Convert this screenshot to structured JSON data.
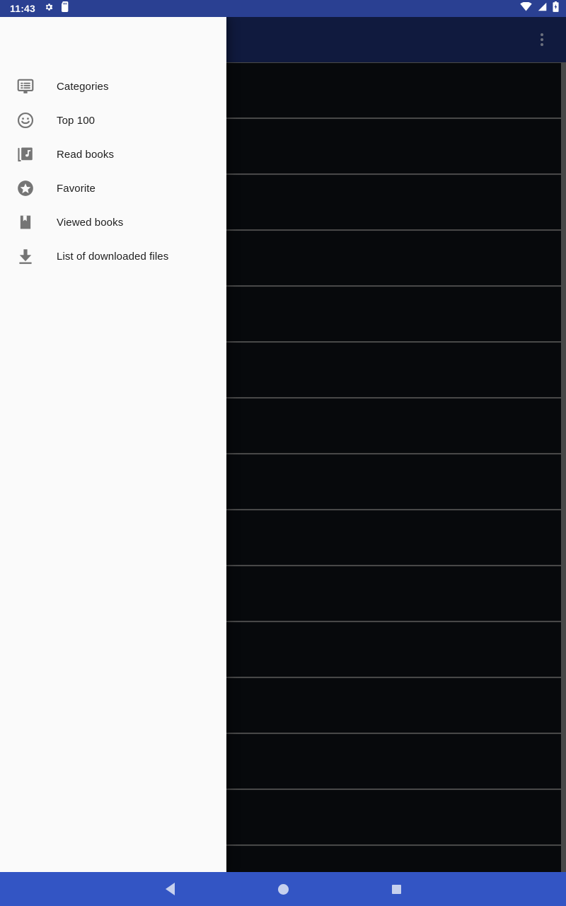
{
  "status_bar": {
    "clock": "11:43",
    "left_icons": [
      "settings-gear-icon",
      "sd-card-icon"
    ],
    "right_icons": [
      "wifi-icon",
      "cellular-signal-icon",
      "battery-icon"
    ],
    "background_color": "#2a4092",
    "text_color": "#ffffff"
  },
  "app_bar": {
    "title": "",
    "overflow_label": "More options",
    "background_color": "#1d2e6b"
  },
  "drawer": {
    "open": true,
    "background_color": "#fafafa",
    "items": [
      {
        "label": "Categories",
        "icon": "categories-monitor-icon"
      },
      {
        "label": "Top 100",
        "icon": "smiley-face-icon"
      },
      {
        "label": "Read books",
        "icon": "music-library-icon"
      },
      {
        "label": "Favorite",
        "icon": "star-circle-icon"
      },
      {
        "label": "Viewed books",
        "icon": "bookmark-book-icon"
      },
      {
        "label": "List of downloaded files",
        "icon": "download-arrow-icon"
      }
    ]
  },
  "book_list": {
    "divider_color": "#7d7d7d",
    "row_color": "#0d1016",
    "rows": [
      {
        "title": ""
      },
      {
        "title": ""
      },
      {
        "title": ""
      },
      {
        "title": ""
      },
      {
        "title": ""
      },
      {
        "title": ""
      },
      {
        "title": ""
      },
      {
        "title": ""
      },
      {
        "title": ""
      },
      {
        "title": ""
      },
      {
        "title": ""
      },
      {
        "title": ""
      },
      {
        "title": ""
      },
      {
        "title": ""
      },
      {
        "title": ""
      }
    ]
  },
  "nav_bar": {
    "background_color": "#3355c4",
    "buttons": [
      {
        "name": "back",
        "icon": "triangle-back-icon"
      },
      {
        "name": "home",
        "icon": "circle-home-icon"
      },
      {
        "name": "recents",
        "icon": "square-recents-icon"
      }
    ]
  }
}
